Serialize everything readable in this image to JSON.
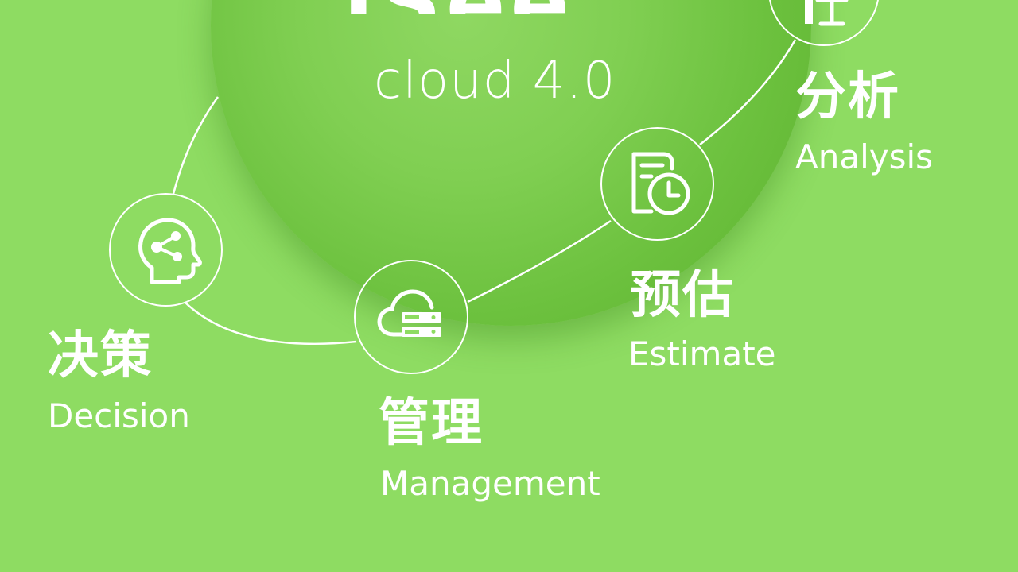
{
  "brand": {
    "top_text_partial": "iSee",
    "subtitle": "cloud 4.0"
  },
  "colors": {
    "background": "#8edc62",
    "sphere": "#6cc13e",
    "foreground": "#ffffff"
  },
  "nodes": [
    {
      "icon": "brain-share-icon",
      "zh": "决策",
      "en": "Decision"
    },
    {
      "icon": "cloud-server-icon",
      "zh": "管理",
      "en": "Management"
    },
    {
      "icon": "document-clock-icon",
      "zh": "预估",
      "en": "Estimate"
    },
    {
      "icon": "chart-icon",
      "zh": "分析",
      "en": "Analysis"
    }
  ]
}
